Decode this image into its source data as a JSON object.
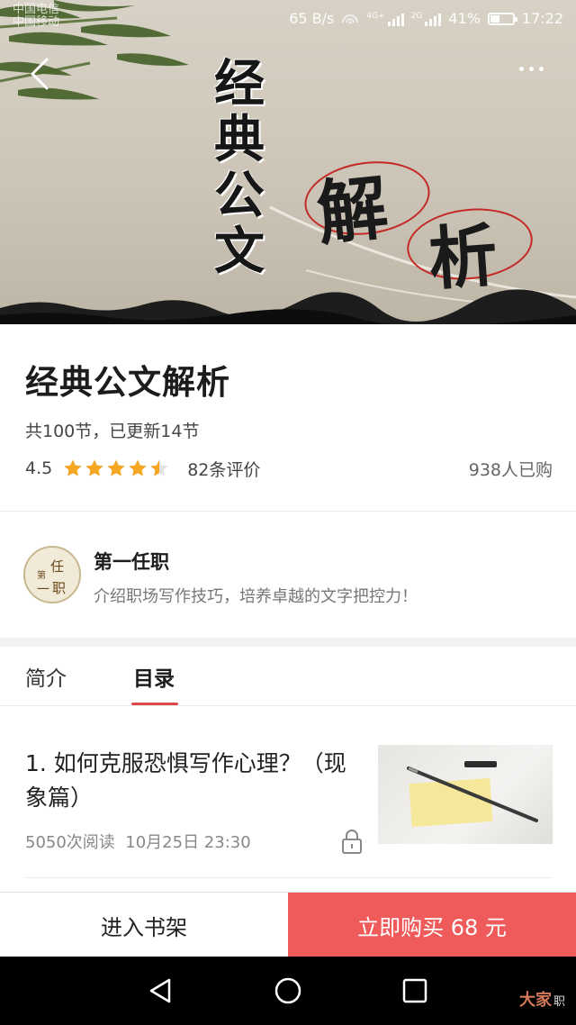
{
  "status_bar": {
    "carrier_1": "中国电信",
    "carrier_2": "中国移动",
    "speed": "65 B/s",
    "net_1": "4G+",
    "net_2": "2G",
    "battery_pct": "41%",
    "battery_level": 0.41,
    "time": "17:22"
  },
  "hero": {
    "cal_chars": [
      "经",
      "典",
      "公",
      "文"
    ],
    "big_chars": [
      "解",
      "析"
    ]
  },
  "course": {
    "title": "经典公文解析",
    "progress_text": "共100节，已更新14节",
    "rating": "4.5",
    "rating_value": 4.5,
    "review_count": "82条评价",
    "buyers": "938人已购"
  },
  "author": {
    "avatar_chars": [
      "第",
      "任",
      "一",
      "职"
    ],
    "name": "第一任职",
    "description": "介绍职场写作技巧，培养卓越的文字把控力！"
  },
  "tabs": {
    "intro": "简介",
    "catalog": "目录",
    "active": "catalog"
  },
  "chapters": [
    {
      "title": "1. 如何克服恐惧写作心理？（现象篇）",
      "views": "5050次阅读",
      "date": "10月25日 23:30",
      "locked": true
    }
  ],
  "bottom_bar": {
    "shelf_label": "进入书架",
    "buy_label": "立即购买 68 元"
  },
  "watermark": {
    "brand": "大家",
    "suffix": "职"
  },
  "colors": {
    "accent_red": "#ef5b5b",
    "tab_underline": "#e24a4a",
    "star": "#f5a623",
    "seal_red": "#c42a25"
  },
  "icons": {
    "back": "chevron-left-icon",
    "more": "more-dots-icon",
    "lock": "lock-icon",
    "nav_back": "triangle-back-icon",
    "nav_home": "circle-home-icon",
    "nav_recent": "square-recent-icon"
  }
}
